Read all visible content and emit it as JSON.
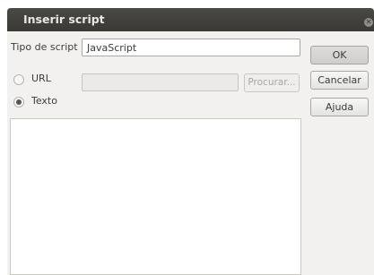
{
  "dialog": {
    "title": "Inserir script",
    "close_icon": "close-icon"
  },
  "script_type": {
    "label": "Tipo de script",
    "value": "JavaScript"
  },
  "url_option": {
    "label": "URL",
    "selected": false,
    "value": ""
  },
  "browse_button": "Procurar...",
  "text_option": {
    "label": "Texto",
    "selected": true,
    "content": ""
  },
  "buttons": {
    "ok": "OK",
    "cancel": "Cancelar",
    "help": "Ajuda"
  }
}
